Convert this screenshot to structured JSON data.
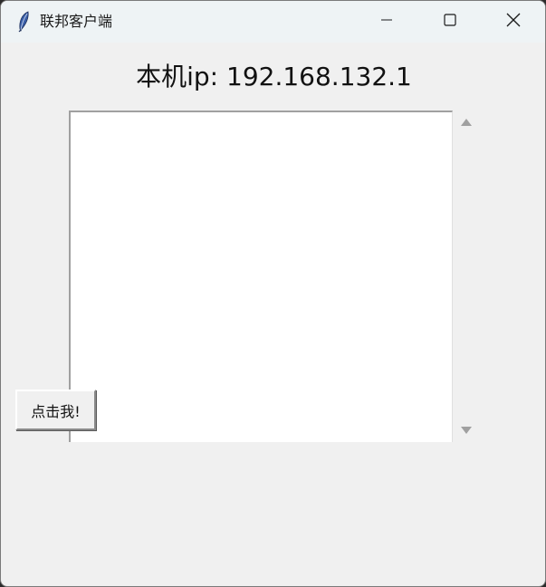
{
  "window": {
    "title": "联邦客户端",
    "app_icon": "feather-icon"
  },
  "title_controls": {
    "minimize_icon": "minimize-icon",
    "maximize_icon": "maximize-icon",
    "close_icon": "close-icon"
  },
  "main": {
    "ip_label": "本机ip: 192.168.132.1",
    "text_area_value": "",
    "button_label": "点击我!"
  },
  "scrollbar": {
    "up_icon": "triangle-up-icon",
    "down_icon": "triangle-down-icon"
  },
  "colors": {
    "window_bg": "#f0f0f0",
    "titlebar_bg": "#eef3f5",
    "text_area_bg": "#ffffff"
  }
}
